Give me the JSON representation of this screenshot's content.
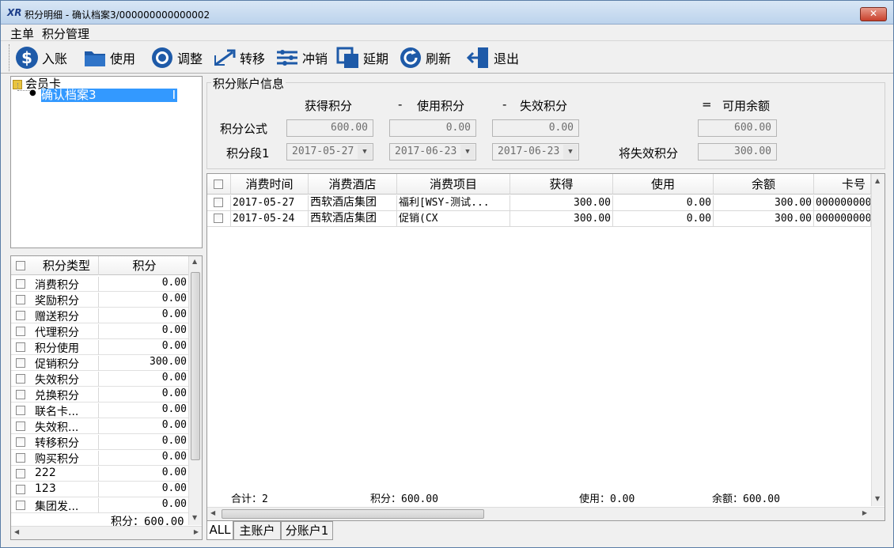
{
  "window": {
    "logo": "XR",
    "title": "积分明细 - 确认档案3/000000000000002",
    "close_label": "✕"
  },
  "menu": [
    "主单",
    "积分管理"
  ],
  "toolbar": [
    {
      "label": "入账",
      "icon": "dollar-icon"
    },
    {
      "label": "使用",
      "icon": "folder-icon"
    },
    {
      "label": "调整",
      "icon": "gear-icon"
    },
    {
      "label": "转移",
      "icon": "transfer-icon"
    },
    {
      "label": "冲销",
      "icon": "list-icon"
    },
    {
      "label": "延期",
      "icon": "extend-icon"
    },
    {
      "label": "刷新",
      "icon": "refresh-icon"
    },
    {
      "label": "退出",
      "icon": "exit-icon"
    }
  ],
  "tree": {
    "root": "会员卡",
    "child": "确认档案3",
    "cursor": "I"
  },
  "points_table": {
    "headers": [
      "积分类型",
      "积分"
    ],
    "rows": [
      [
        "消费积分",
        "0.00"
      ],
      [
        "奖励积分",
        "0.00"
      ],
      [
        "赠送积分",
        "0.00"
      ],
      [
        "代理积分",
        "0.00"
      ],
      [
        "积分使用",
        "0.00"
      ],
      [
        "促销积分",
        "300.00"
      ],
      [
        "失效积分",
        "0.00"
      ],
      [
        "兑换积分",
        "0.00"
      ],
      [
        "联名卡...",
        "0.00"
      ],
      [
        "失效积...",
        "0.00"
      ],
      [
        "转移积分",
        "0.00"
      ],
      [
        "购买积分",
        "0.00"
      ],
      [
        "222",
        "0.00"
      ],
      [
        "123",
        "0.00"
      ],
      [
        "集团发...",
        "0.00"
      ]
    ],
    "footer": "积分：600.00"
  },
  "account": {
    "legend": "积分账户信息",
    "col_labels": {
      "earned": "获得积分",
      "minus1": "-",
      "used": "使用积分",
      "minus2": "-",
      "expired": "失效积分",
      "eq": "=",
      "available": "可用余额"
    },
    "formula_label": "积分公式",
    "formula": {
      "earned": "600.00",
      "used": "0.00",
      "expired": "0.00",
      "available": "600.00"
    },
    "segment_label": "积分段1",
    "segment": {
      "d1": "2017-05-27",
      "d2": "2017-06-23",
      "d3": "2017-06-23"
    },
    "expiring_label": "将失效积分",
    "expiring_value": "300.00"
  },
  "grid": {
    "headers": [
      "消费时间",
      "消费酒店",
      "消费项目",
      "获得",
      "使用",
      "余额",
      "卡号"
    ],
    "rows": [
      [
        "2017-05-27",
        "西软酒店集团",
        "福利[WSY-测试...",
        "300.00",
        "0.00",
        "300.00",
        "000000000"
      ],
      [
        "2017-05-24",
        "西软酒店集团",
        "促销(CX",
        "300.00",
        "0.00",
        "300.00",
        "000000000"
      ]
    ],
    "summary": {
      "total": "合计：2",
      "points": "积分：600.00",
      "used": "使用：0.00",
      "balance": "余额：600.00"
    }
  },
  "tabs": [
    "ALL",
    "主账户",
    "分账户1"
  ]
}
